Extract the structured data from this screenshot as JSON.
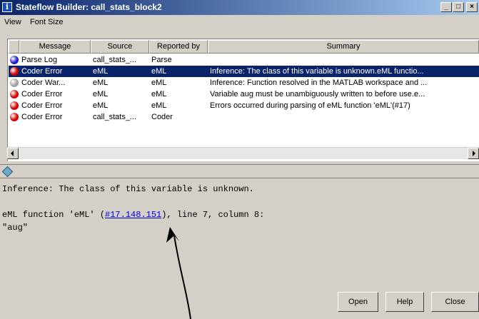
{
  "window": {
    "title": "Stateflow Builder: call_stats_block2",
    "title_icon": "i"
  },
  "window_controls": {
    "minimize": "_",
    "maximize": "□",
    "close": "×"
  },
  "menu": [
    "View",
    "Font Size"
  ],
  "table": {
    "columns": [
      "Message",
      "Source",
      "Reported by",
      "Summary"
    ],
    "rows": [
      {
        "status": "blue",
        "message": "Parse Log",
        "source": "call_stats_...",
        "reported_by": "Parse",
        "summary": ""
      },
      {
        "status": "red",
        "message": "Coder Error",
        "source": "eML",
        "reported_by": "eML",
        "summary": "Inference: The class of this variable is unknown.eML functio...",
        "selected": true
      },
      {
        "status": "gray",
        "message": "Coder War...",
        "source": "eML",
        "reported_by": "eML",
        "summary": "Inference: Function resolved in the MATLAB workspace and ..."
      },
      {
        "status": "red",
        "message": "Coder Error",
        "source": "eML",
        "reported_by": "eML",
        "summary": "Variable aug must be unambiguously written to before use.e..."
      },
      {
        "status": "red",
        "message": "Coder Error",
        "source": "eML",
        "reported_by": "eML",
        "summary": "Errors occurred during parsing of eML function 'eML'(#17)"
      },
      {
        "status": "red",
        "message": "Coder Error",
        "source": "call_stats_...",
        "reported_by": "Coder",
        "summary": ""
      }
    ]
  },
  "status_colors": {
    "blue": "#1a1acc",
    "red": "#d40000",
    "gray": "#a0a0a0"
  },
  "detail": {
    "line1": "Inference: The class of this variable is unknown.",
    "line2_prefix": "eML function 'eML' (",
    "line2_link": "#17.148.151",
    "line2_suffix": "), line 7, column 8:",
    "line3": "\"aug\""
  },
  "buttons": {
    "open": "Open",
    "help": "Help",
    "close": "Close"
  }
}
